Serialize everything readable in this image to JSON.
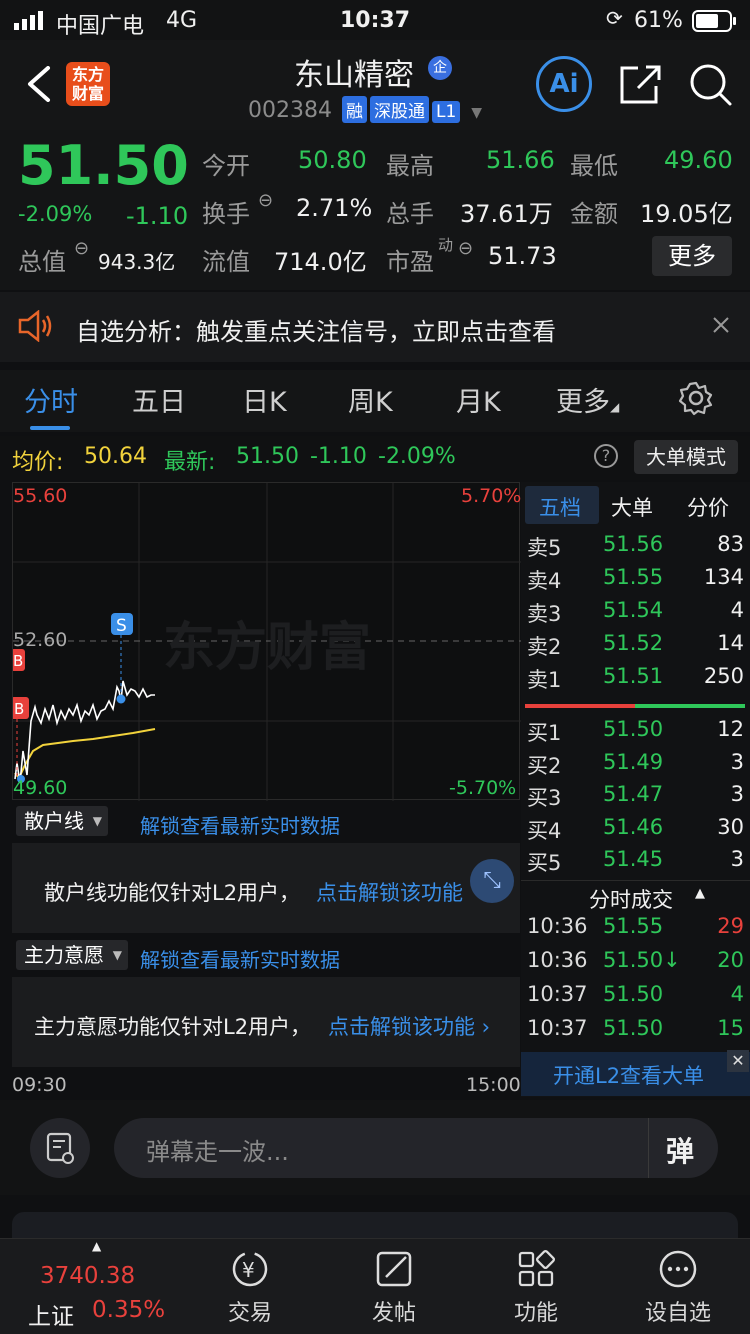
{
  "status": {
    "carrier": "中国广电",
    "network": "4G",
    "time": "10:37",
    "battery": "61%"
  },
  "header": {
    "title": "东山精密",
    "code": "002384",
    "tags": [
      "融",
      "深股通",
      "L1"
    ],
    "logo_text_1": "东方",
    "logo_text_2": "财富",
    "ai_label": "Ai"
  },
  "quote": {
    "price": "51.50",
    "change_pct": "-2.09%",
    "change": "-1.10",
    "open_label": "今开",
    "open": "50.80",
    "high_label": "最高",
    "high": "51.66",
    "low_label": "最低",
    "low": "49.60",
    "turnover_label": "换手",
    "turnover": "2.71%",
    "volume_label": "总手",
    "volume": "37.61万",
    "amount_label": "金额",
    "amount": "19.05亿",
    "mcap_label": "总值",
    "mcap": "943.3亿",
    "float_label": "流值",
    "float": "714.0亿",
    "pe_label": "市盈",
    "pe_sup": "动",
    "pe": "51.73",
    "more": "更多"
  },
  "notice": {
    "text": "自选分析：触发重点关注信号，立即点击查看"
  },
  "tabs": [
    "分时",
    "五日",
    "日K",
    "周K",
    "月K",
    "更多"
  ],
  "info": {
    "avg_label": "均价:",
    "avg": "50.64",
    "latest_label": "最新:",
    "latest": "51.50",
    "chg": "-1.10",
    "pct": "-2.09%",
    "mode_btn": "大单模式"
  },
  "chart": {
    "y_top": "55.60",
    "y_mid": "52.60",
    "y_bot": "49.60",
    "pct_top": "5.70%",
    "pct_bot": "-5.70%",
    "watermark": "东方财富",
    "marker_s": "S",
    "marker_b": "B",
    "time_start": "09:30",
    "time_end": "15:00"
  },
  "sections": {
    "retail": {
      "dropdown": "散户线",
      "link": "解锁查看最新实时数据",
      "body_text": "散户线功能仅针对L2用户，",
      "body_link": "点击解锁该功能"
    },
    "main": {
      "dropdown": "主力意愿",
      "link": "解锁查看最新实时数据",
      "body_text": "主力意愿功能仅针对L2用户，",
      "body_link": "点击解锁该功能"
    }
  },
  "book": {
    "tabs": [
      "五档",
      "大单",
      "分价"
    ],
    "asks": [
      {
        "label": "卖5",
        "price": "51.56",
        "vol": "83"
      },
      {
        "label": "卖4",
        "price": "51.55",
        "vol": "134"
      },
      {
        "label": "卖3",
        "price": "51.54",
        "vol": "4"
      },
      {
        "label": "卖2",
        "price": "51.52",
        "vol": "14"
      },
      {
        "label": "卖1",
        "price": "51.51",
        "vol": "250"
      }
    ],
    "bids": [
      {
        "label": "买1",
        "price": "51.50",
        "vol": "12"
      },
      {
        "label": "买2",
        "price": "51.49",
        "vol": "3"
      },
      {
        "label": "买3",
        "price": "51.47",
        "vol": "3"
      },
      {
        "label": "买4",
        "price": "51.46",
        "vol": "30"
      },
      {
        "label": "买5",
        "price": "51.45",
        "vol": "3"
      }
    ],
    "ticks_title": "分时成交",
    "ticks": [
      {
        "time": "10:36",
        "price": "51.55",
        "vol": "29"
      },
      {
        "time": "10:36",
        "price": "51.50↓",
        "vol": "20"
      },
      {
        "time": "10:37",
        "price": "51.50",
        "vol": "4"
      },
      {
        "time": "10:37",
        "price": "51.50",
        "vol": "15"
      }
    ],
    "l2_banner": "开通L2查看大单"
  },
  "danmu": {
    "placeholder": "弹幕走一波...",
    "btn": "弹"
  },
  "bottom": {
    "index_value": "3740.38",
    "index_name": "上证",
    "index_pct": "0.35%",
    "nav": [
      "交易",
      "发帖",
      "功能",
      "设自选"
    ]
  }
}
